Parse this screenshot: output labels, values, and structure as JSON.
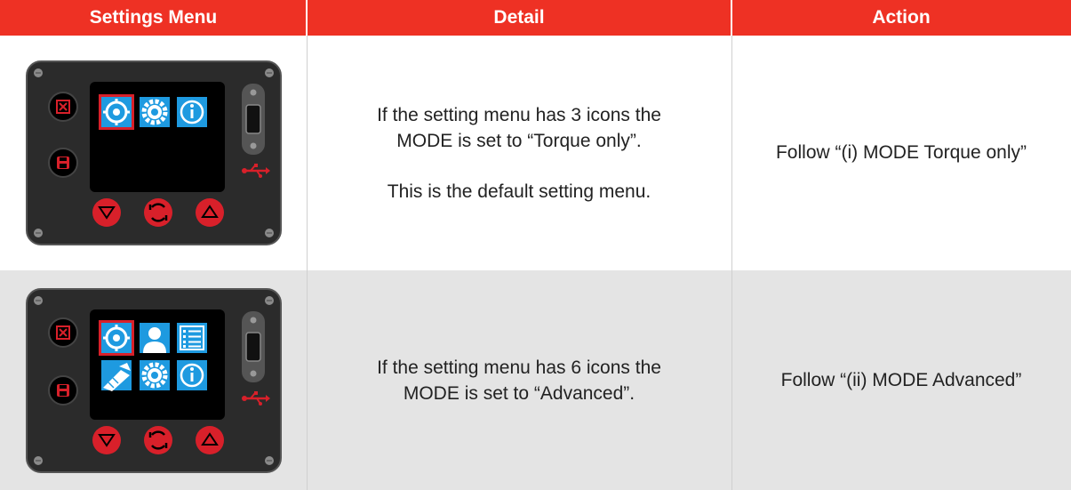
{
  "header": {
    "col1": "Settings Menu",
    "col2": "Detail",
    "col3": "Action"
  },
  "colors": {
    "header_bg": "#ee3124",
    "row_alt_bg": "#e4e4e4",
    "panel_body": "#2b2b2b",
    "screen_icon_blue": "#1e9ae0",
    "button_red": "#d8202a"
  },
  "rows": [
    {
      "detail_line1": "If the setting menu has 3 icons the",
      "detail_line2": "MODE is set to “Torque only”.",
      "detail_line3": "This is the default setting menu.",
      "action": "Follow “(i) MODE Torque only”",
      "screen_icons": [
        "target-icon",
        "gear-icon",
        "info-icon"
      ]
    },
    {
      "detail_line1": "If the setting menu has 6 icons the",
      "detail_line2": "MODE is set to “Advanced”.",
      "action": "Follow “(ii) MODE Advanced”",
      "screen_icons": [
        "target-icon",
        "user-icon",
        "list-icon",
        "wrench-icon",
        "gear-icon",
        "info-icon"
      ]
    }
  ]
}
